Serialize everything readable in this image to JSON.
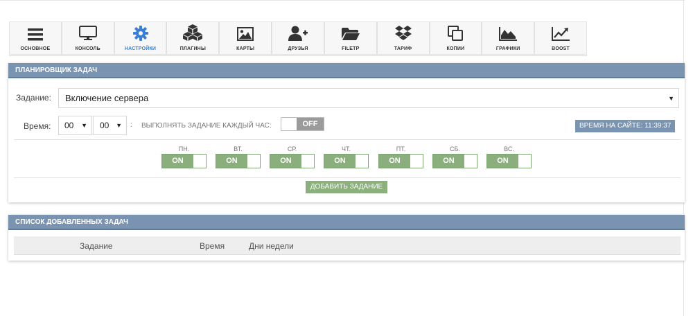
{
  "toolbar": {
    "items": [
      {
        "label": "ОСНОВНОЕ",
        "icon": "menu-icon"
      },
      {
        "label": "КОНСОЛЬ",
        "icon": "monitor-icon"
      },
      {
        "label": "НАСТРОЙКИ",
        "icon": "gear-icon",
        "active": true
      },
      {
        "label": "ПЛАГИНЫ",
        "icon": "cubes-icon"
      },
      {
        "label": "КАРТЫ",
        "icon": "image-icon"
      },
      {
        "label": "ДРУЗЬЯ",
        "icon": "add-user-icon"
      },
      {
        "label": "FILETP",
        "icon": "folder-icon"
      },
      {
        "label": "ТАРИФ",
        "icon": "dropbox-icon"
      },
      {
        "label": "КОПИИ",
        "icon": "copy-icon"
      },
      {
        "label": "ГРАФИКИ",
        "icon": "area-chart-icon"
      },
      {
        "label": "BOOST",
        "icon": "line-chart-icon"
      }
    ],
    "accent": "#3a7fd6"
  },
  "scheduler": {
    "title": "ПЛАНИРОВЩИК ЗАДАЧ",
    "task_label": "Задание:",
    "task_value": "Включение сервера",
    "time_label": "Время:",
    "hour_value": "00",
    "minute_value": "00",
    "colon": ":",
    "hourly_label": "ВЫПОЛНЯТЬ ЗАДАНИЕ КАЖДЫЙ ЧАС:",
    "hourly_state": "OFF",
    "site_time": "ВРЕМЯ НА САЙТЕ: 11:39:37",
    "days": [
      {
        "name": "ПН.",
        "state": "ON"
      },
      {
        "name": "ВТ.",
        "state": "ON"
      },
      {
        "name": "СР.",
        "state": "ON"
      },
      {
        "name": "ЧТ.",
        "state": "ON"
      },
      {
        "name": "ПТ.",
        "state": "ON"
      },
      {
        "name": "СБ.",
        "state": "ON"
      },
      {
        "name": "ВС.",
        "state": "ON"
      }
    ],
    "add_button": "ДОБАВИТЬ ЗАДАНИЕ"
  },
  "task_list": {
    "title": "СПИСОК ДОБАВЛЕННЫХ ЗАДАЧ",
    "columns": [
      "Задание",
      "Время",
      "Дни недели"
    ]
  },
  "colors": {
    "panel_header": "#7a93b1",
    "toggle_on": "#8aaf7d",
    "toggle_off": "#9b9b9b"
  }
}
